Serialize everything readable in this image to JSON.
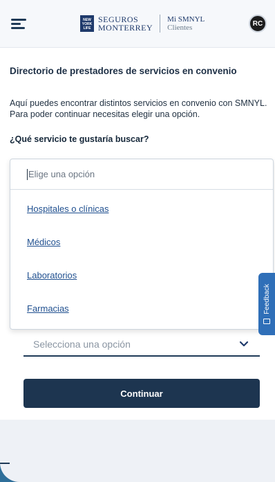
{
  "header": {
    "brand_logo_text": "NEW YORK LIFE",
    "brand_line1": "SEGUROS",
    "brand_line2": "MONTERREY",
    "portal_line1": "Mi SMNYL",
    "portal_line2": "Clientes",
    "avatar_initials": "RC"
  },
  "main": {
    "title": "Directorio de prestadores de servicios en convenio",
    "intro": "Aquí puedes encontrar distintos servicios en convenio con SMNYL. Para poder continuar necesitas elegir una opción.",
    "question": "¿Qué servicio te gustaría buscar?",
    "dropdown": {
      "placeholder": "Elige una opción",
      "options": [
        "Hospitales o clínicas",
        "Médicos",
        "Laboratorios",
        "Farmacias"
      ]
    },
    "second_select_placeholder": "Selecciona una opción",
    "continue_label": "Continuar"
  },
  "feedback": {
    "label": "Feedback"
  },
  "colors": {
    "primary": "#1d3550",
    "link": "#1f4f8f",
    "feedback": "#2f6fb8"
  }
}
